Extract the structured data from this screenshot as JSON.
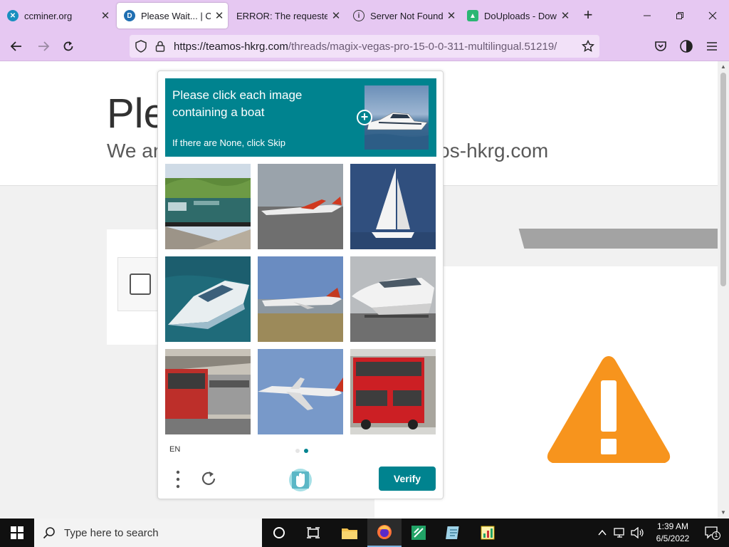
{
  "browser": {
    "tabs": [
      {
        "title": "ccminer.org",
        "icon": "ccminer-favicon-icon",
        "active": false
      },
      {
        "title": "Please Wait... | Cloudflare",
        "icon": "cloudflare-favicon-icon",
        "active": true
      },
      {
        "title": "ERROR: The requested URL",
        "icon": "none",
        "active": false
      },
      {
        "title": "Server Not Found",
        "icon": "info-icon",
        "active": false
      },
      {
        "title": "DoUploads - Download",
        "icon": "douploads-favicon-icon",
        "active": false
      }
    ],
    "url_host": "https://teamos-hkrg.com",
    "url_path": "/threads/magix-vegas-pro-15-0-0-311-multilingual.51219/",
    "accent": "#e6c8f2"
  },
  "page": {
    "title_partial": "Ple",
    "subtitle_partial_left": "We ar",
    "subtitle_partial_right": "os-hkrg.com",
    "warning_color": "#f7941d"
  },
  "captcha": {
    "prompt": "Please click each image containing a boat",
    "hint": "If there are None, click Skip",
    "example": "boat",
    "tiles": [
      {
        "subject": "train",
        "selected": false
      },
      {
        "subject": "airplane",
        "selected": false
      },
      {
        "subject": "sailboat",
        "selected": false
      },
      {
        "subject": "boat",
        "selected": false
      },
      {
        "subject": "airplane",
        "selected": false
      },
      {
        "subject": "boat",
        "selected": false
      },
      {
        "subject": "train",
        "selected": false
      },
      {
        "subject": "airplane",
        "selected": false
      },
      {
        "subject": "bus",
        "selected": false
      }
    ],
    "language": "EN",
    "page_count": 2,
    "current_page": 2,
    "verify_label": "Verify",
    "accent": "#00838f"
  },
  "taskbar": {
    "search_placeholder": "Type here to search",
    "time": "1:39 AM",
    "date": "6/5/2022",
    "notification_count": "1"
  }
}
